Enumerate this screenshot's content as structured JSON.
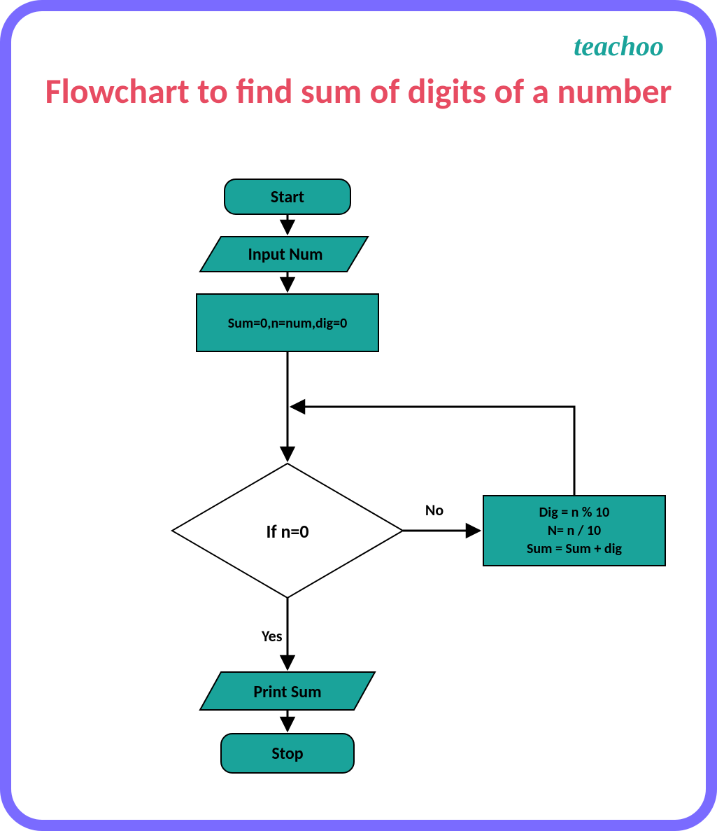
{
  "brand": "teachoo",
  "title": "Flowchart to find sum of digits of a number",
  "nodes": {
    "start": "Start",
    "input": "Input Num",
    "init": "Sum=0,n=num,dig=0",
    "decision": "If  n=0",
    "loop_body_l1": "Dig = n % 10",
    "loop_body_l2": "N= n / 10",
    "loop_body_l3": "Sum =  Sum + dig",
    "output": "Print Sum",
    "stop": "Stop"
  },
  "edges": {
    "no": "No",
    "yes": "Yes"
  }
}
